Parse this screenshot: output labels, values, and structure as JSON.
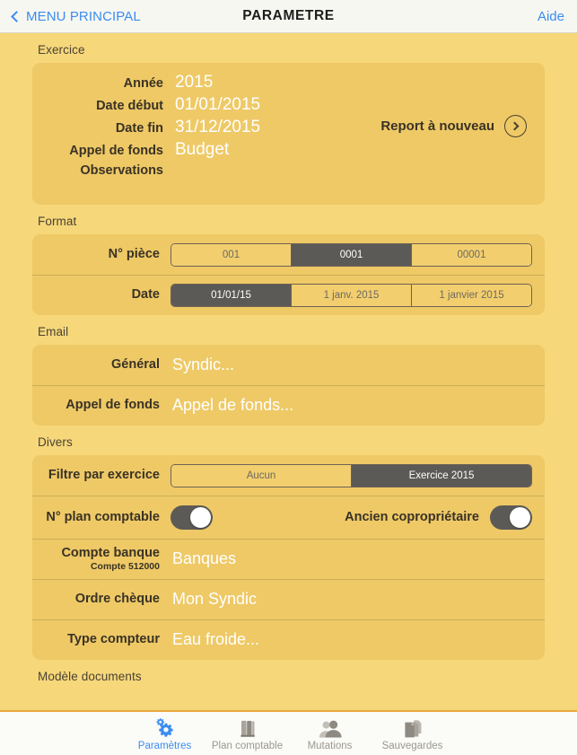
{
  "navbar": {
    "back_label": "MENU PRINCIPAL",
    "title": "PARAMETRE",
    "help_label": "Aide",
    "back_icon": "chevron-left-icon",
    "accent_color": "#3b8cf0"
  },
  "sections": {
    "exercice": {
      "title": "Exercice",
      "fields": [
        {
          "label": "Année",
          "value": "2015"
        },
        {
          "label": "Date début",
          "value": "01/01/2015"
        },
        {
          "label": "Date fin",
          "value": "31/12/2015"
        },
        {
          "label": "Appel de fonds",
          "value": "Budget"
        },
        {
          "label": "Observations",
          "value": ""
        }
      ],
      "action": {
        "label": "Report à nouveau",
        "icon": "chevron-right-circle-icon"
      }
    },
    "format": {
      "title": "Format",
      "rows": [
        {
          "label": "N° pièce",
          "options": [
            "001",
            "0001",
            "00001"
          ],
          "selected": "0001",
          "selected_index": 1
        },
        {
          "label": "Date",
          "options": [
            "01/01/15",
            "1 janv. 2015",
            "1 janvier 2015"
          ],
          "selected": "01/01/15",
          "selected_index": 0
        }
      ]
    },
    "email": {
      "title": "Email",
      "rows": [
        {
          "label": "Général",
          "value": "Syndic..."
        },
        {
          "label": "Appel de fonds",
          "value": "Appel de fonds..."
        }
      ]
    },
    "divers": {
      "title": "Divers",
      "filter": {
        "label": "Filtre par exercice",
        "options": [
          "Aucun",
          "Exercice 2015"
        ],
        "selected": "Exercice 2015",
        "selected_index": 1
      },
      "toggles": [
        {
          "label": "N° plan comptable",
          "state": "on"
        },
        {
          "label": "Ancien copropriétaire",
          "state": "on"
        }
      ],
      "rows": [
        {
          "label": "Compte banque",
          "sublabel": "Compte 512000",
          "value": "Banques"
        },
        {
          "label": "Ordre chèque",
          "sublabel": "",
          "value": "Mon Syndic"
        },
        {
          "label": "Type compteur",
          "sublabel": "",
          "value": "Eau froide..."
        }
      ]
    },
    "modele": {
      "title": "Modèle documents"
    }
  },
  "tabbar": {
    "tabs": [
      {
        "label": "Paramètres",
        "icon": "gears-icon",
        "active": true
      },
      {
        "label": "Plan comptable",
        "icon": "books-icon",
        "active": false
      },
      {
        "label": "Mutations",
        "icon": "people-icon",
        "active": false
      },
      {
        "label": "Sauvegardes",
        "icon": "documents-icon",
        "active": false
      }
    ],
    "active_color": "#3b8cf0",
    "inactive_color": "#9a978f"
  },
  "colors": {
    "page_background": "#f6d77a",
    "card_background": "#eec966",
    "segment_selected": "#5c5a57",
    "value_text": "#ffffff",
    "tabbar_border": "#e8a93b"
  }
}
